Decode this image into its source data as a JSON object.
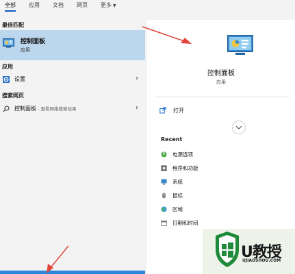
{
  "tabs": [
    {
      "label": "全部",
      "active": true
    },
    {
      "label": "应用",
      "active": false
    },
    {
      "label": "文档",
      "active": false
    },
    {
      "label": "网页",
      "active": false
    },
    {
      "label": "更多",
      "active": false,
      "dropdown": true
    }
  ],
  "left": {
    "best_match_heading": "最佳匹配",
    "best_match": {
      "title": "控制面板",
      "subtitle": "应用",
      "icon": "control-panel-icon"
    },
    "apps_heading": "应用",
    "apps": [
      {
        "label": "设置",
        "icon": "gear-icon"
      }
    ],
    "web_heading": "搜索网页",
    "web": [
      {
        "label": "控制面板",
        "hint": " - 查看网络搜索结果",
        "icon": "search-icon"
      }
    ]
  },
  "right": {
    "title": "控制面板",
    "subtitle": "应用",
    "open_label": "打开",
    "recent_heading": "Recent",
    "recent": [
      {
        "label": "电源选项",
        "icon": "power-options-icon"
      },
      {
        "label": "程序和功能",
        "icon": "programs-features-icon"
      },
      {
        "label": "系统",
        "icon": "system-icon"
      },
      {
        "label": "鼠标",
        "icon": "mouse-icon"
      },
      {
        "label": "区域",
        "icon": "region-icon"
      },
      {
        "label": "日期和时间",
        "icon": "datetime-icon"
      }
    ]
  },
  "watermark": {
    "text": "U教授",
    "url": "UJIAOSHOU.COM"
  },
  "colors": {
    "accent": "#0a5bc4",
    "selection": "#bcd6ee",
    "arrow": "#e0443a",
    "taskbar_accent": "#2c86d9",
    "watermark_green": "#1e8a3a"
  }
}
